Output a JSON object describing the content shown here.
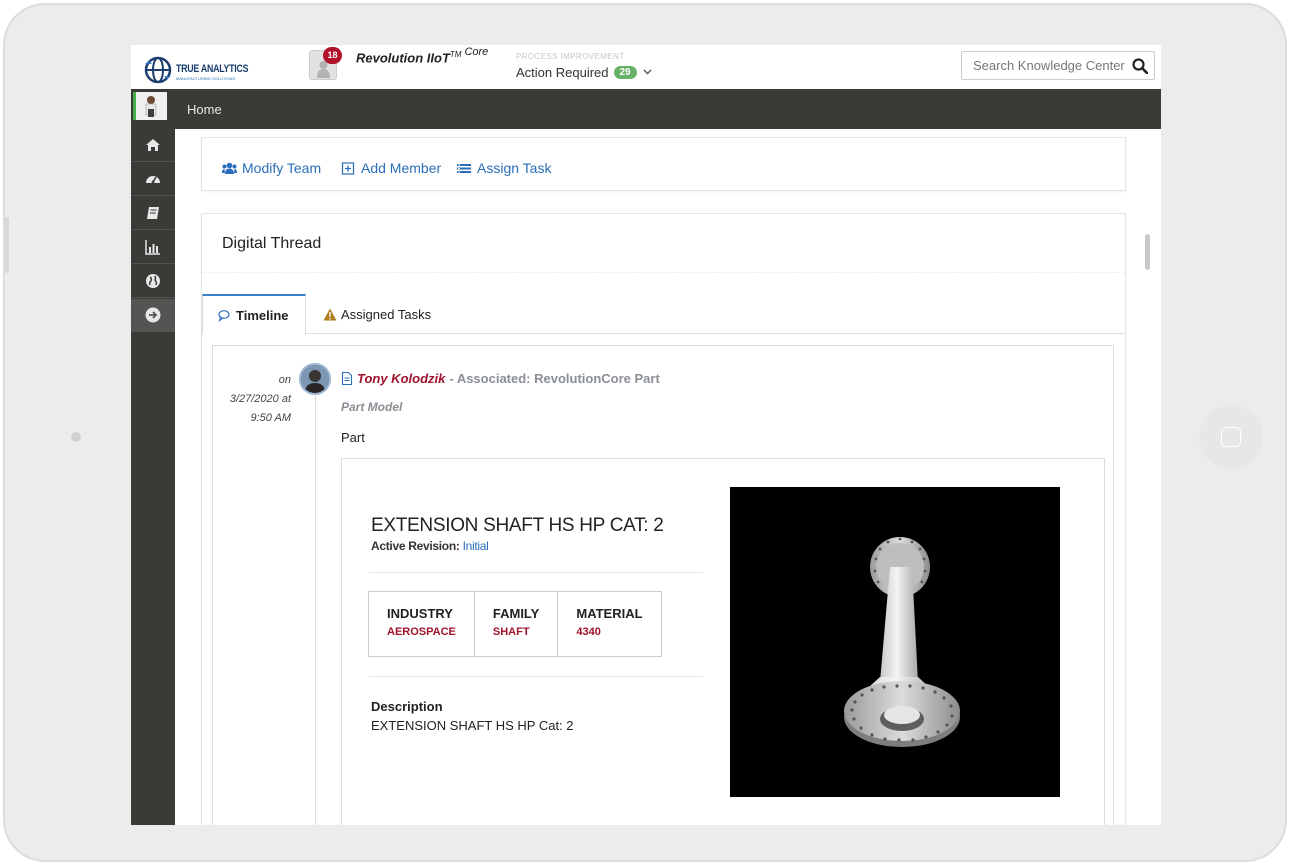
{
  "header": {
    "brand": "TRUE ANALYTICS",
    "brand_sub": "MANUFACTURING SOLUTIONS",
    "notifications_count": "18",
    "product_name": "Revolution IIoT",
    "product_tm": "TM",
    "product_edition": "Core",
    "process_label": "PROCESS IMPROVEMENT",
    "action_required_label": "Action Required",
    "action_required_count": "29",
    "search_placeholder": "Search Knowledge Center"
  },
  "navbar": {
    "breadcrumb": "Home"
  },
  "sidebar": {
    "items": [
      {
        "icon": "home-icon"
      },
      {
        "icon": "dashboard-icon"
      },
      {
        "icon": "book-icon"
      },
      {
        "icon": "bar-chart-icon"
      },
      {
        "icon": "globe-icon"
      },
      {
        "icon": "arrow-right-circle-icon"
      }
    ]
  },
  "toolbar": {
    "modify_team": "Modify Team",
    "add_member": "Add Member",
    "assign_task": "Assign Task"
  },
  "digital_thread": {
    "title": "Digital Thread",
    "tabs": [
      {
        "label": "Timeline",
        "active": true
      },
      {
        "label": "Assigned Tasks",
        "active": false
      }
    ]
  },
  "timeline_entry": {
    "date_on": "on",
    "date": "3/27/2020 at",
    "time": "9:50 AM",
    "user": "Tony Kolodzik",
    "action": "- Associated: RevolutionCore Part",
    "model_type": "Part Model",
    "object_type": "Part"
  },
  "part": {
    "title": "EXTENSION SHAFT HS HP CAT: 2",
    "revision_label": "Active Revision:",
    "revision_value": "Initial",
    "attributes": [
      {
        "key": "INDUSTRY",
        "value": "AEROSPACE"
      },
      {
        "key": "FAMILY",
        "value": "SHAFT"
      },
      {
        "key": "MATERIAL",
        "value": "4340"
      }
    ],
    "description_label": "Description",
    "description": "EXTENSION SHAFT HS HP Cat: 2"
  },
  "colors": {
    "accent_blue": "#2a6ebb",
    "brand_red": "#a0122d",
    "nav_dark": "#3b3a37",
    "badge_green": "#67b267"
  }
}
